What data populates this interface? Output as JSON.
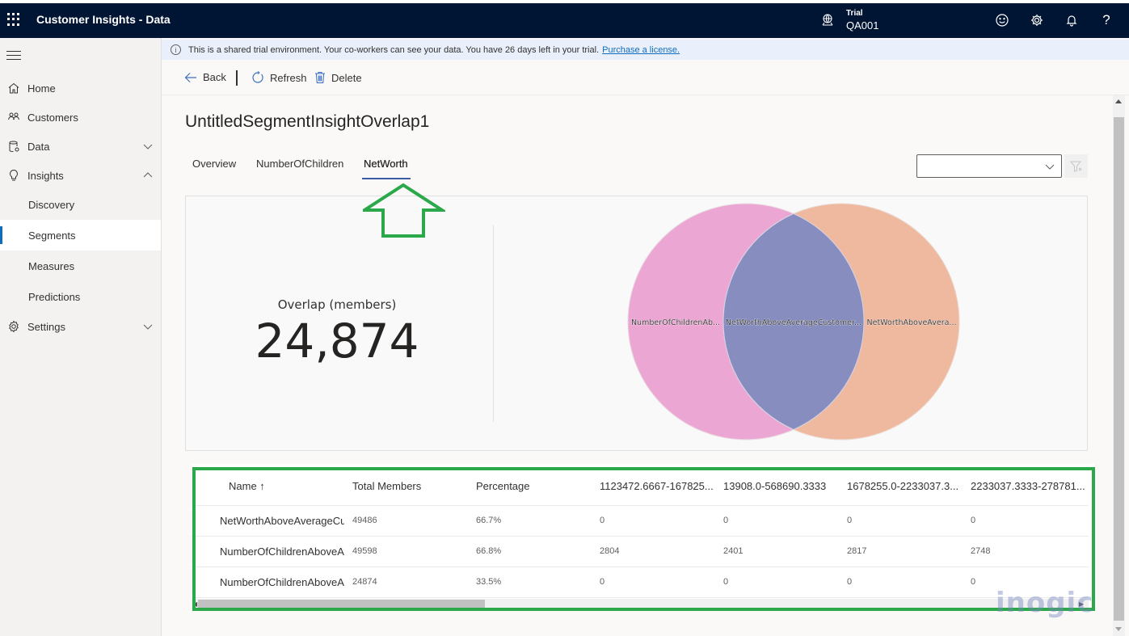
{
  "topbar": {
    "app_title": "Customer Insights - Data",
    "environment_label": "Trial",
    "environment_name": "QA001",
    "icons": [
      "app-launcher-icon",
      "environment-icon",
      "feedback-smiley-icon",
      "settings-gear-icon",
      "notifications-bell-icon",
      "help-icon"
    ]
  },
  "sidebar": {
    "items": [
      {
        "label": "Home",
        "icon": "home-icon"
      },
      {
        "label": "Customers",
        "icon": "customers-icon"
      },
      {
        "label": "Data",
        "icon": "data-icon",
        "expandable": true,
        "expanded": false
      },
      {
        "label": "Insights",
        "icon": "lightbulb-icon",
        "expandable": true,
        "expanded": true
      },
      {
        "label": "Discovery",
        "sub": true
      },
      {
        "label": "Segments",
        "sub": true,
        "active": true
      },
      {
        "label": "Measures",
        "sub": true
      },
      {
        "label": "Predictions",
        "sub": true
      },
      {
        "label": "Settings",
        "icon": "settings-icon",
        "expandable": true,
        "expanded": false
      }
    ]
  },
  "banner": {
    "message": "This is a shared trial environment. Your co-workers can see your data. You have 26 days left in your trial.",
    "link": "Purchase a license."
  },
  "commands": {
    "back": "Back",
    "refresh": "Refresh",
    "delete": "Delete"
  },
  "page": {
    "title": "UntitledSegmentInsightOverlap1",
    "tabs": [
      {
        "label": "Overview",
        "active": false
      },
      {
        "label": "NumberOfChildren",
        "active": false
      },
      {
        "label": "NetWorth",
        "active": true
      }
    ],
    "dropdown_value": ""
  },
  "summary": {
    "overlap_label": "Overlap (members)",
    "overlap_value": "24,874"
  },
  "chart_data": {
    "type": "venn",
    "sets": [
      {
        "label": "NumberOfChildrenAb...",
        "size": 49598,
        "color": "#eca6d4"
      },
      {
        "label": "NetWorthAboveAvera...",
        "size": 49486,
        "color": "#efb9a0"
      }
    ],
    "intersection": {
      "label": "NetWorthAboveAverageCustomer...",
      "size": 24874,
      "color": "#878dbf"
    }
  },
  "table": {
    "columns": [
      "Name ↑",
      "Total Members",
      "Percentage",
      "1123472.6667-167825...",
      "13908.0-568690.3333",
      "1678255.0-2233037.3...",
      "2233037.3333-278781..."
    ],
    "rows": [
      [
        "NetWorthAboveAverageCus",
        "49486",
        "66.7%",
        "0",
        "0",
        "0",
        "0"
      ],
      [
        "NumberOfChildrenAboveAv",
        "49598",
        "66.8%",
        "2804",
        "2401",
        "2817",
        "2748"
      ],
      [
        "NumberOfChildrenAboveAv",
        "24874",
        "33.5%",
        "0",
        "0",
        "0",
        "0"
      ]
    ]
  },
  "watermark": "inogic"
}
